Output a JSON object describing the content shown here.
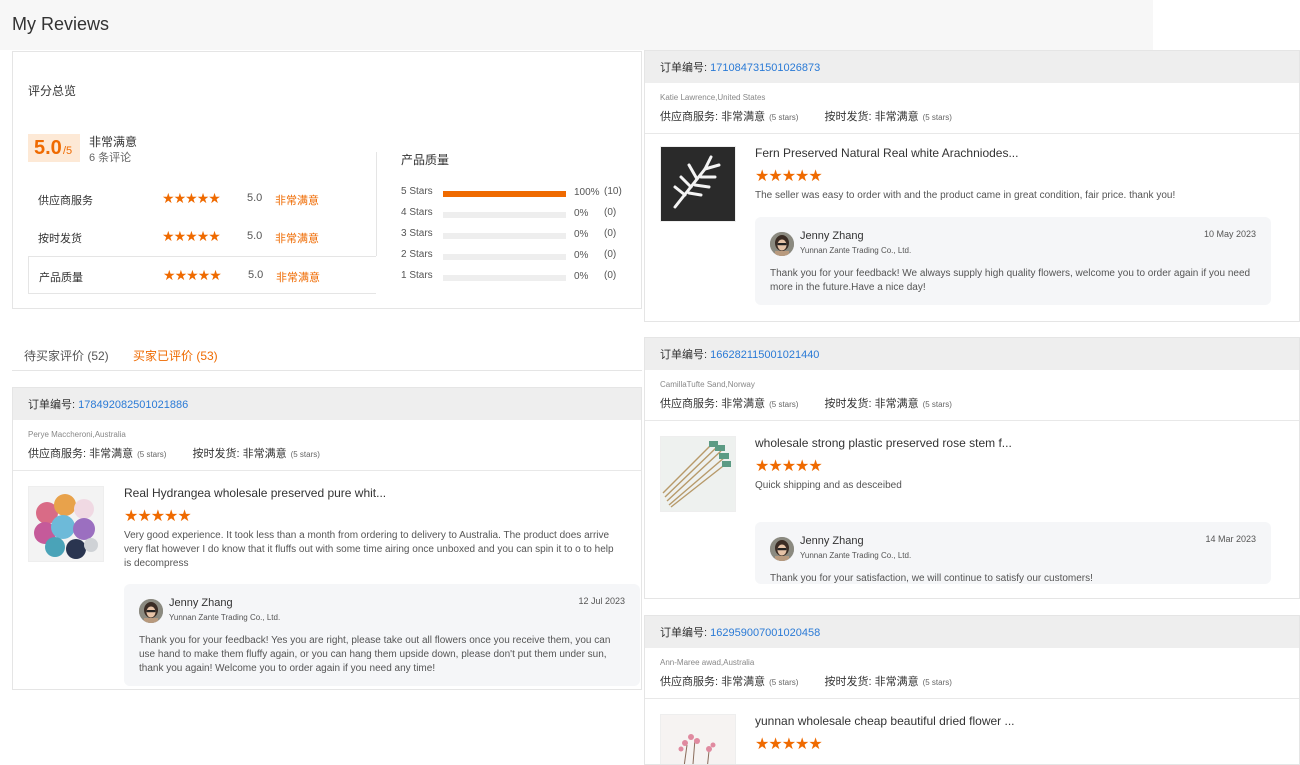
{
  "page": {
    "title": "My Reviews"
  },
  "summary": {
    "heading": "评分总览",
    "score": "5.0",
    "score_max": "/5",
    "score_label": "非常满意",
    "review_count": "6 条评论",
    "rows": [
      {
        "label": "供应商服务",
        "value": "5.0",
        "text": "非常满意",
        "stars": 5
      },
      {
        "label": "按时发货",
        "value": "5.0",
        "text": "非常满意",
        "stars": 5
      },
      {
        "label": "产品质量",
        "value": "5.0",
        "text": "非常满意",
        "stars": 5
      }
    ],
    "distribution_title": "产品质量",
    "distribution": [
      {
        "label": "5 Stars",
        "pct": "100%",
        "count": "(10)",
        "fraction": 1.0
      },
      {
        "label": "4 Stars",
        "pct": "0%",
        "count": "(0)",
        "fraction": 0
      },
      {
        "label": "3 Stars",
        "pct": "0%",
        "count": "(0)",
        "fraction": 0
      },
      {
        "label": "2 Stars",
        "pct": "0%",
        "count": "(0)",
        "fraction": 0
      },
      {
        "label": "1 Stars",
        "pct": "0%",
        "count": "(0)",
        "fraction": 0
      }
    ]
  },
  "tabs": [
    {
      "label": "待买家评价 (52)",
      "active": false
    },
    {
      "label": "买家已评价 (53)",
      "active": true
    }
  ],
  "labels": {
    "order": "订单编号:",
    "service": "供应商服务:",
    "shipping": "按时发货:",
    "satisfied": "非常满意",
    "stars_note": "(5 stars)"
  },
  "reviews": [
    {
      "order_no": "178492082501021886",
      "buyer": "Perye Maccheroni,Australia",
      "product": "Real Hydrangea wholesale preserved pure whit...",
      "rating": 5,
      "text": "Very good experience. It took less than a month from ordering to delivery to Australia.  The product does arrive very flat however I do know that it fluffs out with some time airing once unboxed and you can spin it to o to help is decompress",
      "reply": {
        "name": "Jenny Zhang",
        "company": "Yunnan Zante Trading Co., Ltd.",
        "date": "12 Jul 2023",
        "message": "Thank you for your feedback! Yes you are right, please take out all flowers once you receive them, you can use hand to make them fluffy again, or you can hang them upside down, please don't put them under sun, thank you again! Welcome you to order again if you need any time!"
      }
    },
    {
      "order_no": "171084731501026873",
      "buyer": "Katie Lawrence,United States",
      "product": "Fern Preserved Natural Real white Arachniodes...",
      "rating": 5,
      "text": "The seller was easy to order with and the product came in great condition,  fair price. thank you!",
      "reply": {
        "name": "Jenny Zhang",
        "company": "Yunnan Zante Trading Co., Ltd.",
        "date": "10 May 2023",
        "message": "Thank you for your feedback! We always supply high quality flowers, welcome you to order again if you need more in the future.Have a nice day!"
      }
    },
    {
      "order_no": "166282115001021440",
      "buyer": "CamillaTufte Sand,Norway",
      "product": "wholesale strong plastic preserved rose stem f...",
      "rating": 5,
      "text": "Quick shipping and as desceibed",
      "reply": {
        "name": "Jenny Zhang",
        "company": "Yunnan Zante Trading Co., Ltd.",
        "date": "14 Mar 2023",
        "message": "Thank you for your satisfaction, we will continue to satisfy our customers!"
      }
    },
    {
      "order_no": "162959007001020458",
      "buyer": "Ann-Maree awad,Australia",
      "product": "yunnan wholesale cheap beautiful dried flower ...",
      "rating": 5
    }
  ],
  "colors": {
    "accent": "#ef6a00",
    "link": "#2a7ad6"
  }
}
